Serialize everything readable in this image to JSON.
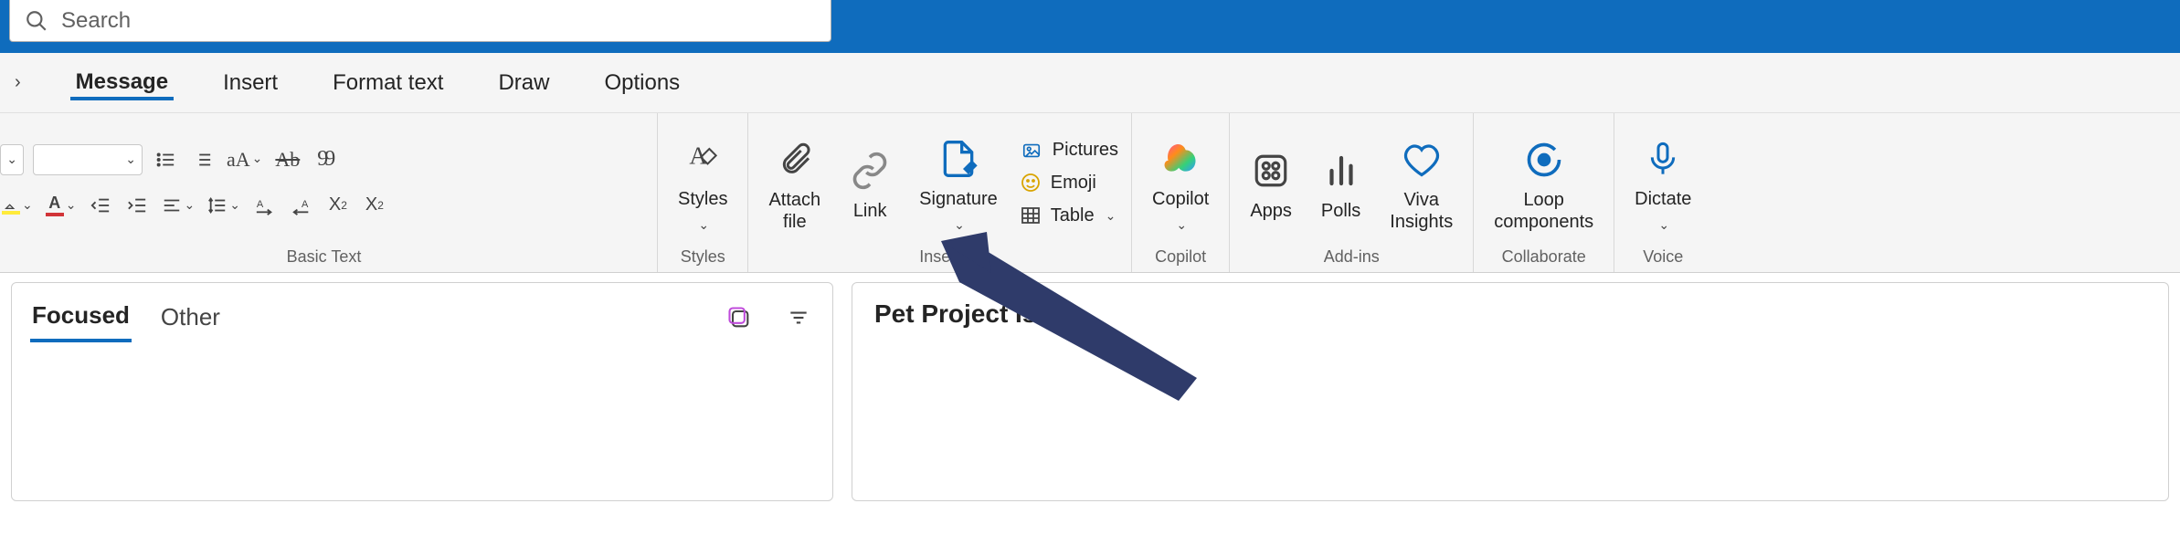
{
  "search": {
    "placeholder": "Search"
  },
  "tabs": {
    "message": "Message",
    "insert": "Insert",
    "format_text": "Format text",
    "draw": "Draw",
    "options": "Options"
  },
  "ribbon": {
    "basic_text": {
      "label": "Basic Text",
      "aa": "aA",
      "ab": "Ab",
      "quote": "99"
    },
    "styles": {
      "btn": "Styles",
      "label": "Styles"
    },
    "insert": {
      "attach": "Attach\nfile",
      "link": "Link",
      "signature": "Signature",
      "pictures": "Pictures",
      "emoji": "Emoji",
      "table": "Table",
      "label": "Insert"
    },
    "copilot": {
      "btn": "Copilot",
      "label": "Copilot"
    },
    "addins": {
      "apps": "Apps",
      "polls": "Polls",
      "viva": "Viva\nInsights",
      "label": "Add-ins"
    },
    "collaborate": {
      "loop": "Loop\ncomponents",
      "label": "Collaborate"
    },
    "voice": {
      "dictate": "Dictate",
      "label": "Voice"
    }
  },
  "mail": {
    "focused": "Focused",
    "other": "Other",
    "subject": "Pet Project Issue"
  }
}
